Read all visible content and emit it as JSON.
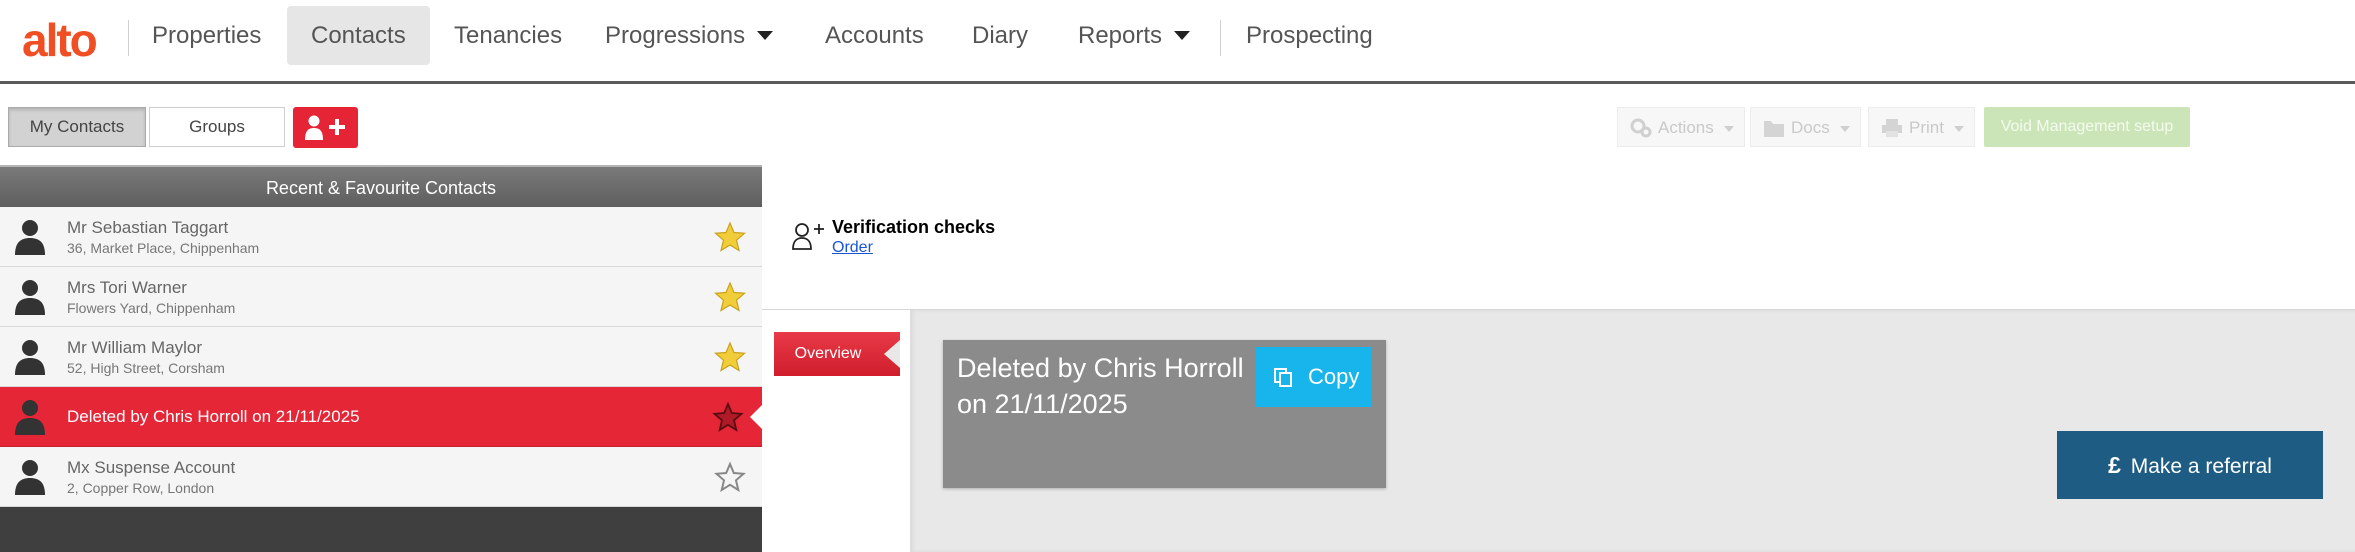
{
  "app": {
    "logo_text": "alto",
    "brand_color": "#f04e23"
  },
  "nav": {
    "items": [
      {
        "label": "Properties",
        "active": false,
        "has_caret": false
      },
      {
        "label": "Contacts",
        "active": true,
        "has_caret": false
      },
      {
        "label": "Tenancies",
        "active": false,
        "has_caret": false
      },
      {
        "label": "Progressions",
        "active": false,
        "has_caret": true
      },
      {
        "label": "Accounts",
        "active": false,
        "has_caret": false
      },
      {
        "label": "Diary",
        "active": false,
        "has_caret": false
      },
      {
        "label": "Reports",
        "active": false,
        "has_caret": true
      },
      {
        "label": "Prospecting",
        "active": false,
        "has_caret": false
      }
    ]
  },
  "toolbar": {
    "my_contacts": "My Contacts",
    "groups": "Groups",
    "add_contact_icon": "add-user-icon",
    "actions": "Actions",
    "docs": "Docs",
    "print": "Print",
    "void_management": "Void Management setup"
  },
  "left_panel": {
    "title": "Recent & Favourite Contacts",
    "contacts": [
      {
        "name": "Mr Sebastian Taggart",
        "address": "36, Market Place, Chippenham",
        "favourite": true,
        "selected": false
      },
      {
        "name": "Mrs Tori Warner",
        "address": "Flowers Yard, Chippenham",
        "favourite": true,
        "selected": false
      },
      {
        "name": "Mr William Maylor",
        "address": "52, High Street, Corsham",
        "favourite": true,
        "selected": false
      },
      {
        "name": "Deleted by Chris Horroll on 21/11/2025",
        "address": "",
        "favourite": false,
        "selected": true
      },
      {
        "name": "Mx Suspense Account",
        "address": "2, Copper Row, London",
        "favourite": false,
        "selected": false
      }
    ]
  },
  "verification": {
    "title": "Verification checks",
    "link": "Order"
  },
  "overview": {
    "tab_label": "Overview",
    "deleted_text": "Deleted by Chris Horroll on 21/11/2025",
    "copy_label": "Copy",
    "referral_symbol": "£",
    "referral_label": "Make a referral"
  },
  "colors": {
    "selected_red": "#e42636",
    "copy_blue": "#18b4ec",
    "referral_blue": "#1e5c84",
    "star_gold": "#f2cd3a",
    "void_green": "#cbe5b8"
  }
}
